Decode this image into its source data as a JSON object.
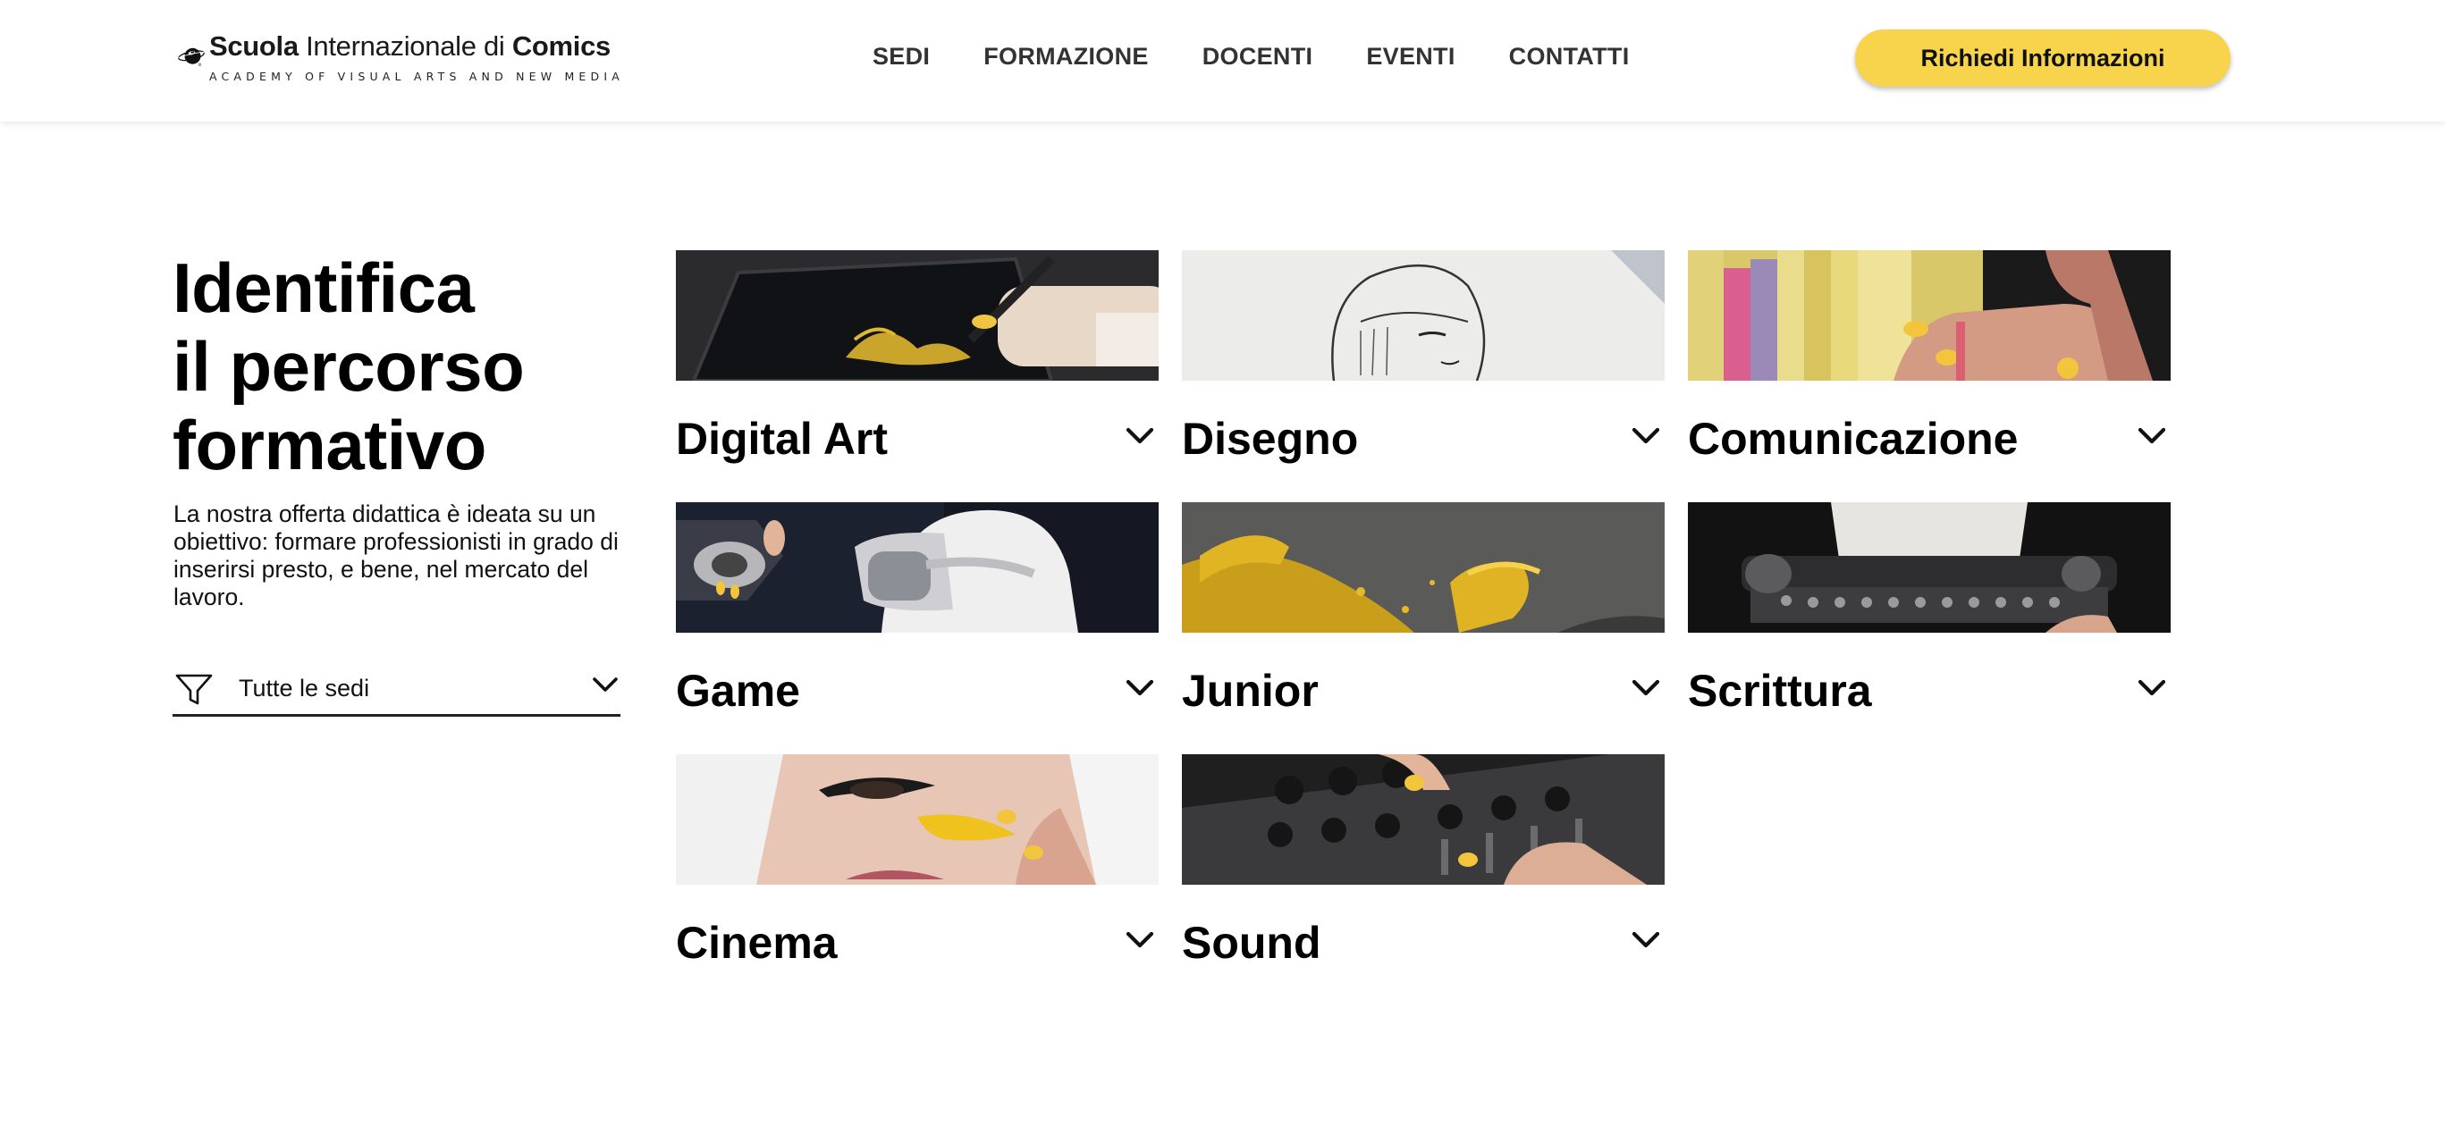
{
  "header": {
    "logo": {
      "title_regular": "Scuola Internazionale di ",
      "title_bold": "Comics",
      "title_prefix_bold": "Scuola",
      "subtitle": "ACADEMY OF VISUAL ARTS AND NEW MEDIA"
    },
    "nav": [
      "SEDI",
      "FORMAZIONE",
      "DOCENTI",
      "EVENTI",
      "CONTATTI"
    ],
    "cta_label": "Richiedi Informazioni",
    "cta_color": "#f7d44c"
  },
  "hero": {
    "title_lines": [
      "Identifica",
      "il percorso",
      "formativo"
    ],
    "description": "La nostra offerta didattica è ideata su un obiettivo: formare professionisti in grado di inserirsi presto, e bene, nel mercato del lavoro."
  },
  "filter": {
    "icon": "funnel-icon",
    "label": "Tutte le sedi"
  },
  "courses": [
    {
      "title": "Digital Art",
      "image": "drawing-tablet-photo"
    },
    {
      "title": "Disegno",
      "image": "pencil-sketch-photo"
    },
    {
      "title": "Comunicazione",
      "image": "color-swatches-photo"
    },
    {
      "title": "Game",
      "image": "vr-headset-photo"
    },
    {
      "title": "Junior",
      "image": "yellow-paint-photo"
    },
    {
      "title": "Scrittura",
      "image": "typewriter-photo"
    },
    {
      "title": "Cinema",
      "image": "makeup-face-photo"
    },
    {
      "title": "Sound",
      "image": "audio-mixer-photo"
    }
  ],
  "accent_color": "#f7d44c"
}
